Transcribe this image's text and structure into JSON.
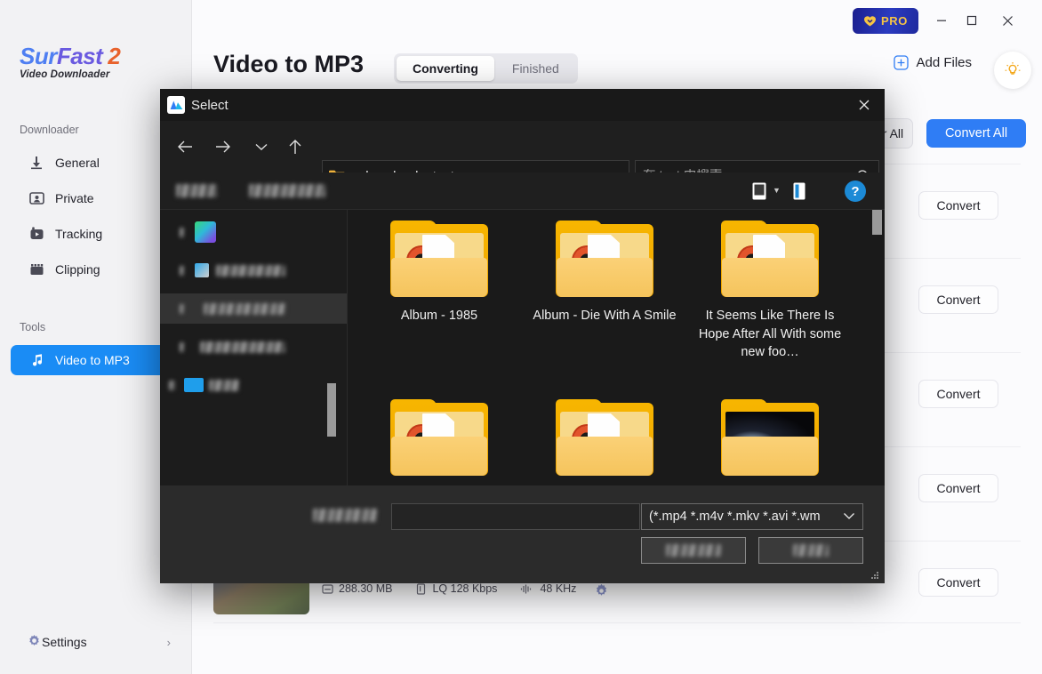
{
  "app": {
    "brand": {
      "l1": "Sur",
      "l2": "Fast",
      "l3": "2",
      "sub": "Video Downloader"
    },
    "window": {
      "pro_label": "PRO",
      "minimize": "minimize-icon",
      "maximize": "maximize-icon",
      "close": "close-icon"
    }
  },
  "sidebar": {
    "section_downloader": "Downloader",
    "section_tools": "Tools",
    "items": [
      {
        "label": "General",
        "icon": "download-arrow-icon",
        "active": false
      },
      {
        "label": "Private",
        "icon": "private-person-icon",
        "active": false
      },
      {
        "label": "Tracking",
        "icon": "tracking-camera-icon",
        "active": false
      },
      {
        "label": "Clipping",
        "icon": "clipping-film-icon",
        "active": false
      }
    ],
    "tools": [
      {
        "label": "Video to MP3",
        "icon": "music-note-icon",
        "active": true
      }
    ],
    "settings": {
      "label": "Settings",
      "icon": "gear-icon",
      "chevron": "chevron-right-icon"
    }
  },
  "main": {
    "title": "Video to MP3",
    "tabs": [
      {
        "label": "Converting",
        "active": true
      },
      {
        "label": "Finished",
        "active": false
      }
    ],
    "add_files": "Add Files",
    "add_files_icon": "plus-circle-icon",
    "bulb_icon": "lightbulb-icon",
    "clear_all": "Clear All",
    "convert_all": "Convert All",
    "convert_rows": [
      "Convert",
      "Convert",
      "Convert",
      "Convert",
      "Convert"
    ],
    "file_row": {
      "size": "288.30 MB",
      "size_icon": "file-size-icon",
      "quality": "LQ 128 Kbps",
      "quality_icon": "bitrate-icon",
      "samplerate": "48 KHz",
      "samplerate_icon": "waveform-icon",
      "gear_icon": "gear-icon"
    }
  },
  "dialog": {
    "title": "Select",
    "logo_icon": "app-logo-icon",
    "close_icon": "close-icon",
    "nav": {
      "back_icon": "arrow-left-icon",
      "forward_icon": "arrow-right-icon",
      "recent_icon": "chevron-down-icon",
      "up_icon": "arrow-up-icon",
      "refresh_icon": "refresh-icon"
    },
    "breadcrumb": {
      "folder_icon": "folder-icon",
      "overflow": "«",
      "parts": [
        "download",
        "test"
      ],
      "separator": "›",
      "dropdown_icon": "chevron-down-icon"
    },
    "search": {
      "placeholder": "在 test 中搜索",
      "value": "",
      "icon": "search-icon"
    },
    "toolbar": {
      "view_icon": "view-layout-icon",
      "view_dropdown_icon": "caret-down-icon",
      "pane_icon": "preview-pane-icon",
      "help": "?",
      "help_icon": "help-icon"
    },
    "files": [
      {
        "name": "Album - 1985",
        "icon": "folder-with-media-icon"
      },
      {
        "name": "Album - Die With A Smile",
        "icon": "folder-with-media-icon"
      },
      {
        "name": "It Seems Like There Is Hope After All With some new foo…",
        "icon": "folder-with-media-icon"
      },
      {
        "name": "",
        "icon": "folder-with-media-icon"
      },
      {
        "name": "",
        "icon": "folder-with-media-icon"
      },
      {
        "name": "",
        "icon": "folder-with-image-icon"
      }
    ],
    "bottom": {
      "filename_label": "",
      "filename_value": "",
      "filter_value": "(*.mp4 *.m4v *.mkv *.avi *.wm",
      "filter_dropdown_icon": "chevron-down-icon",
      "open_button": "",
      "cancel_button": "",
      "grip_icon": "resize-grip-icon"
    }
  },
  "colors": {
    "accent_blue": "#2f7df5",
    "sidebar_active": "#1a8cf5",
    "dialog_bg": "#1f1f1f",
    "dialog_bottom": "#2b2b2b",
    "folder_yellow": "#f7b500",
    "pro_gold": "#f6c444",
    "help_blue": "#1c8ad6"
  }
}
